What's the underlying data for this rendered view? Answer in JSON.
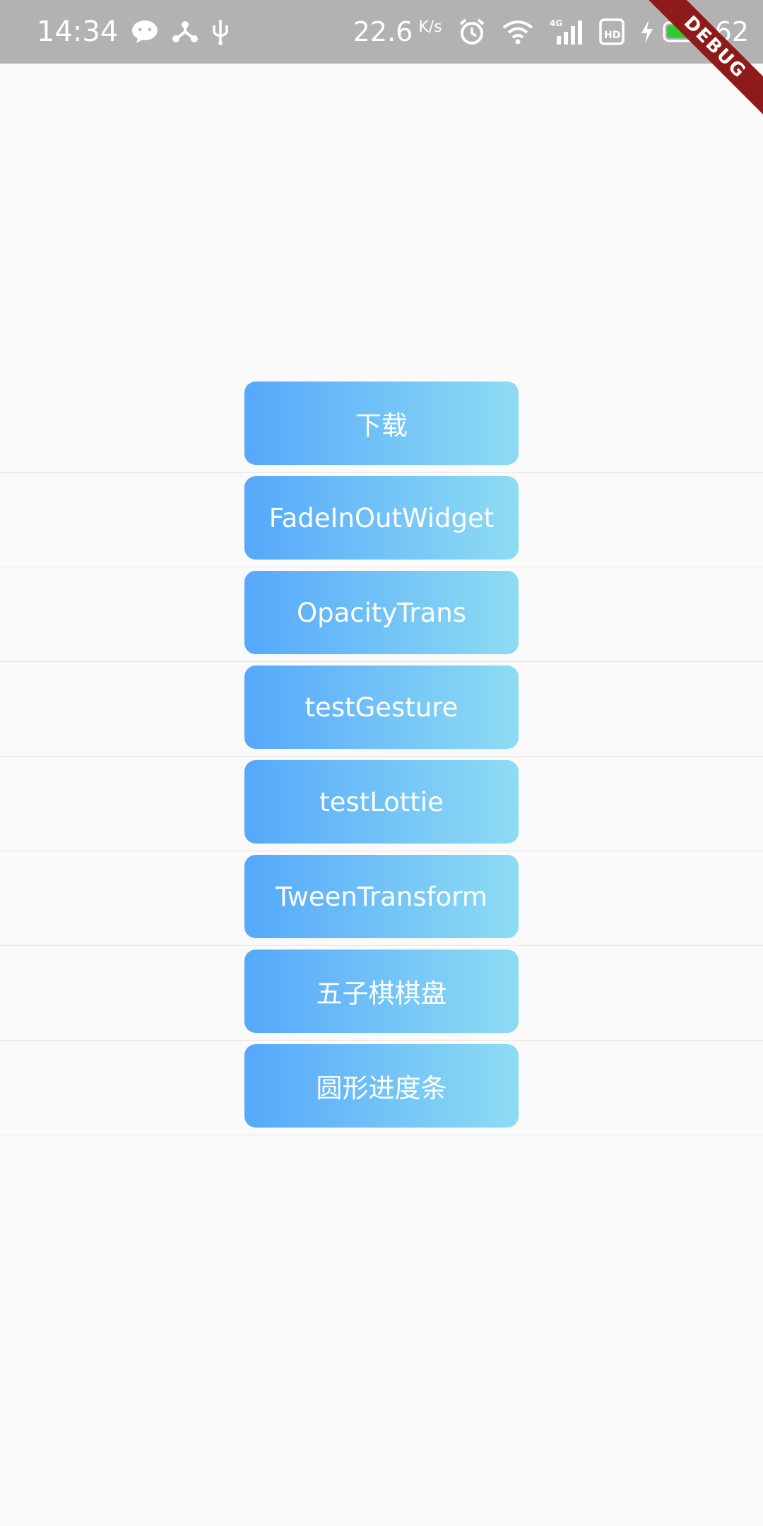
{
  "status_bar": {
    "time": "14:34",
    "net_speed": "22.6",
    "net_speed_unit": "K/s",
    "battery_level": "62",
    "icons": [
      "wechat-icon",
      "share-icon",
      "usb-icon",
      "alarm-icon",
      "wifi-icon",
      "signal-4g-icon",
      "hd-icon",
      "charging-icon",
      "battery-icon"
    ]
  },
  "debug_banner": "DEBUG",
  "buttons": [
    {
      "label": "下载"
    },
    {
      "label": "FadeInOutWidget"
    },
    {
      "label": "OpacityTrans"
    },
    {
      "label": "testGesture"
    },
    {
      "label": "testLottie"
    },
    {
      "label": "TweenTransform"
    },
    {
      "label": "五子棋棋盘"
    },
    {
      "label": "圆形进度条"
    }
  ],
  "colors": {
    "status_bar_bg": "#b2b2b2",
    "page_bg": "#fafafa",
    "button_gradient_start": "#55a8fb",
    "button_gradient_end": "#8edcf3",
    "debug_banner_bg": "#8e1a1a",
    "battery_fill": "#2ecc2e"
  }
}
